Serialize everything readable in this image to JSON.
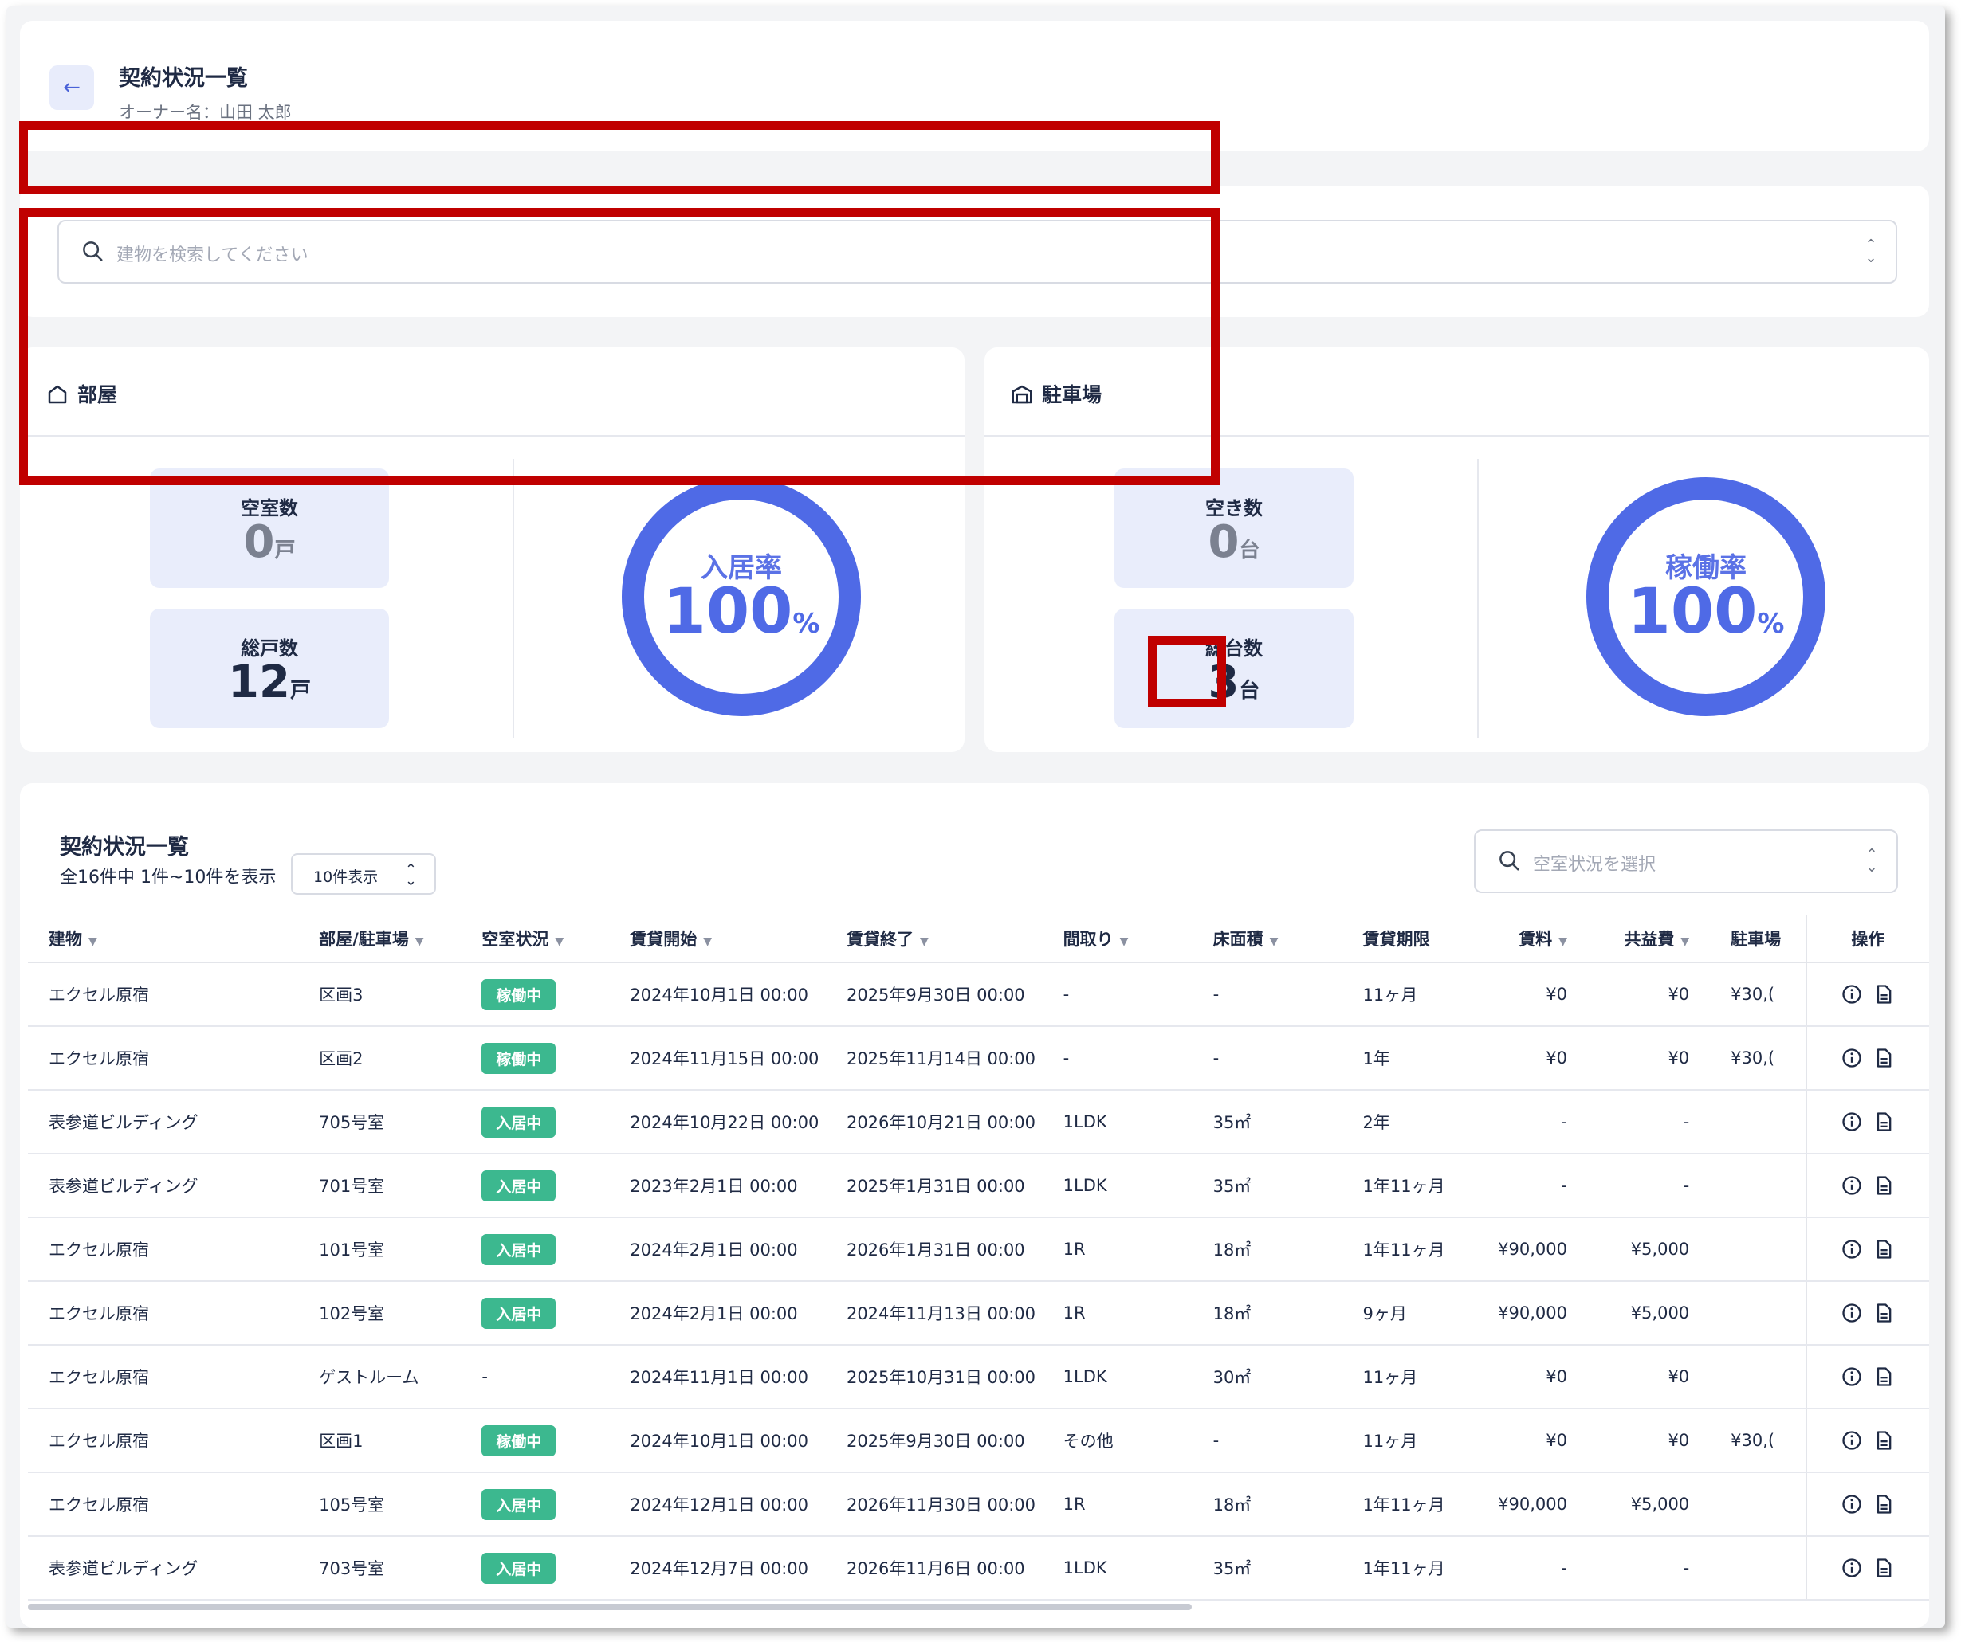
{
  "header": {
    "back_icon": "arrow-left-icon",
    "title": "契約状況一覧",
    "owner": "オーナー名：山田 太郎"
  },
  "building_search": {
    "placeholder": "建物を検索してください"
  },
  "rooms": {
    "title": "部屋",
    "vacant_label": "空室数",
    "vacant_value": "0",
    "vacant_unit": "戸",
    "total_label": "総戸数",
    "total_value": "12",
    "total_unit": "戸",
    "rate_label": "入居率",
    "rate_value": "100",
    "rate_unit": "%",
    "rate_fraction": 1.0
  },
  "parking": {
    "title": "駐車場",
    "vacant_label": "空き数",
    "vacant_value": "0",
    "vacant_unit": "台",
    "total_label": "総台数",
    "total_value": "3",
    "total_unit": "台",
    "rate_label": "稼働率",
    "rate_value": "100",
    "rate_unit": "%",
    "rate_fraction": 1.0
  },
  "list": {
    "title": "契約状況一覧",
    "count_text": "全16件中 1件~10件を表示",
    "per_page": "10件表示",
    "status_filter_placeholder": "空室状況を選択"
  },
  "table": {
    "columns": [
      "建物",
      "部屋/駐車場",
      "空室状況",
      "賃貸開始",
      "賃貸終了",
      "間取り",
      "床面積",
      "賃貸期限",
      "賃料",
      "共益費",
      "駐車場",
      "操作"
    ],
    "rows": [
      {
        "building": "エクセル原宿",
        "room": "区画3",
        "status": "稼働中",
        "start": "2024年10月1日 00:00",
        "end": "2025年9月30日 00:00",
        "layout": "-",
        "area": "-",
        "term": "11ヶ月",
        "rent": "¥0",
        "fee": "¥0",
        "parking": "¥30,("
      },
      {
        "building": "エクセル原宿",
        "room": "区画2",
        "status": "稼働中",
        "start": "2024年11月15日 00:00",
        "end": "2025年11月14日 00:00",
        "layout": "-",
        "area": "-",
        "term": "1年",
        "rent": "¥0",
        "fee": "¥0",
        "parking": "¥30,("
      },
      {
        "building": "表参道ビルディング",
        "room": "705号室",
        "status": "入居中",
        "start": "2024年10月22日 00:00",
        "end": "2026年10月21日 00:00",
        "layout": "1LDK",
        "area": "35㎡",
        "term": "2年",
        "rent": "-",
        "fee": "-",
        "parking": ""
      },
      {
        "building": "表参道ビルディング",
        "room": "701号室",
        "status": "入居中",
        "start": "2023年2月1日 00:00",
        "end": "2025年1月31日 00:00",
        "layout": "1LDK",
        "area": "35㎡",
        "term": "1年11ヶ月",
        "rent": "-",
        "fee": "-",
        "parking": ""
      },
      {
        "building": "エクセル原宿",
        "room": "101号室",
        "status": "入居中",
        "start": "2024年2月1日 00:00",
        "end": "2026年1月31日 00:00",
        "layout": "1R",
        "area": "18㎡",
        "term": "1年11ヶ月",
        "rent": "¥90,000",
        "fee": "¥5,000",
        "parking": ""
      },
      {
        "building": "エクセル原宿",
        "room": "102号室",
        "status": "入居中",
        "start": "2024年2月1日 00:00",
        "end": "2024年11月13日 00:00",
        "layout": "1R",
        "area": "18㎡",
        "term": "9ヶ月",
        "rent": "¥90,000",
        "fee": "¥5,000",
        "parking": ""
      },
      {
        "building": "エクセル原宿",
        "room": "ゲストルーム",
        "status": "-",
        "start": "2024年11月1日 00:00",
        "end": "2025年10月31日 00:00",
        "layout": "1LDK",
        "area": "30㎡",
        "term": "11ヶ月",
        "rent": "¥0",
        "fee": "¥0",
        "parking": ""
      },
      {
        "building": "エクセル原宿",
        "room": "区画1",
        "status": "稼働中",
        "start": "2024年10月1日 00:00",
        "end": "2025年9月30日 00:00",
        "layout": "その他",
        "area": "-",
        "term": "11ヶ月",
        "rent": "¥0",
        "fee": "¥0",
        "parking": "¥30,("
      },
      {
        "building": "エクセル原宿",
        "room": "105号室",
        "status": "入居中",
        "start": "2024年12月1日 00:00",
        "end": "2026年11月30日 00:00",
        "layout": "1R",
        "area": "18㎡",
        "term": "1年11ヶ月",
        "rent": "¥90,000",
        "fee": "¥5,000",
        "parking": ""
      },
      {
        "building": "表参道ビルディング",
        "room": "703号室",
        "status": "入居中",
        "start": "2024年12月7日 00:00",
        "end": "2026年11月6日 00:00",
        "layout": "1LDK",
        "area": "35㎡",
        "term": "1年11ヶ月",
        "rent": "-",
        "fee": "-",
        "parking": ""
      }
    ],
    "op_icons": [
      "info-icon",
      "document-icon"
    ]
  },
  "colors": {
    "accent": "#4f6ae6",
    "badge_green": "#3cb88f",
    "stat_bg": "#e9edfb",
    "highlight_red": "#c00000"
  }
}
